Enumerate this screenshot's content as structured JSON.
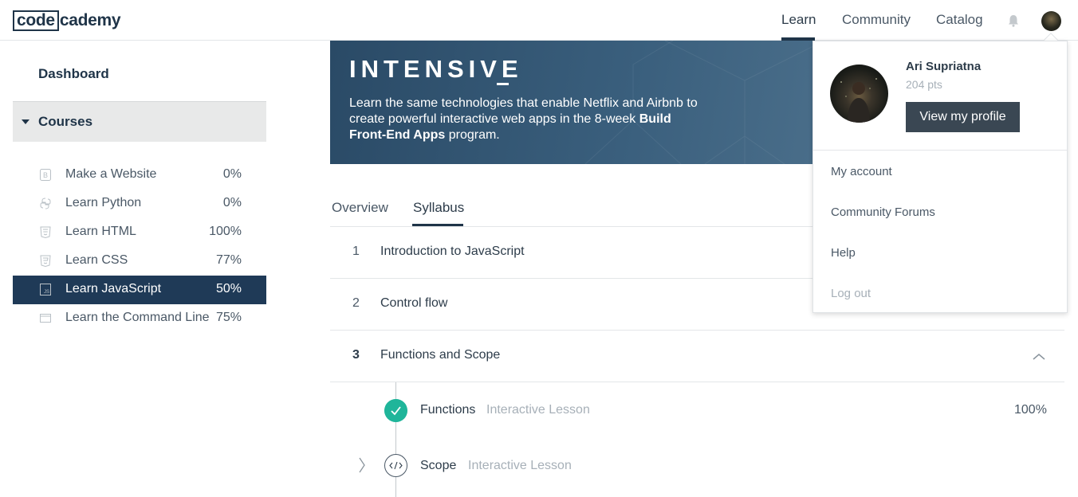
{
  "header": {
    "logo_boxed": "code",
    "logo_rest": "cademy",
    "nav": {
      "learn": "Learn",
      "community": "Community",
      "catalog": "Catalog"
    }
  },
  "sidebar": {
    "dashboard": "Dashboard",
    "courses_label": "Courses",
    "courses": [
      {
        "name": "Make a Website",
        "pct": "0%",
        "icon": "bootstrap-icon"
      },
      {
        "name": "Learn Python",
        "pct": "0%",
        "icon": "python-icon"
      },
      {
        "name": "Learn HTML",
        "pct": "100%",
        "icon": "html5-icon"
      },
      {
        "name": "Learn CSS",
        "pct": "77%",
        "icon": "css3-icon"
      },
      {
        "name": "Learn JavaScript",
        "pct": "50%",
        "icon": "js-icon",
        "active": true
      },
      {
        "name": "Learn the Command Line",
        "pct": "75%",
        "icon": "terminal-icon"
      }
    ]
  },
  "banner": {
    "title": "INTENSIVE",
    "text_1": "Learn the same technologies that enable Netflix and Airbnb to create powerful interactive web apps in the 8-week ",
    "text_bold": "Build Front-End Apps",
    "text_2": " program."
  },
  "tabs": {
    "overview": "Overview",
    "syllabus": "Syllabus",
    "active": "Syllabus"
  },
  "syllabus": [
    {
      "num": "1",
      "title": "Introduction to JavaScript"
    },
    {
      "num": "2",
      "title": "Control flow"
    },
    {
      "num": "3",
      "title": "Functions and Scope",
      "open": true
    }
  ],
  "lessons": [
    {
      "name": "Functions",
      "type": "Interactive Lesson",
      "pct": "100%",
      "status": "complete"
    },
    {
      "name": "Scope",
      "type": "Interactive Lesson",
      "status": "not-started"
    }
  ],
  "dropdown": {
    "name": "Ari Supriatna",
    "points": "204 pts",
    "profile_button": "View my profile",
    "items": {
      "account": "My account",
      "forums": "Community Forums",
      "help": "Help",
      "logout": "Log out"
    }
  },
  "colors": {
    "navy": "#1f3a57",
    "success": "#1fb59a",
    "button": "#3a4753",
    "muted": "#a7b0b8"
  }
}
